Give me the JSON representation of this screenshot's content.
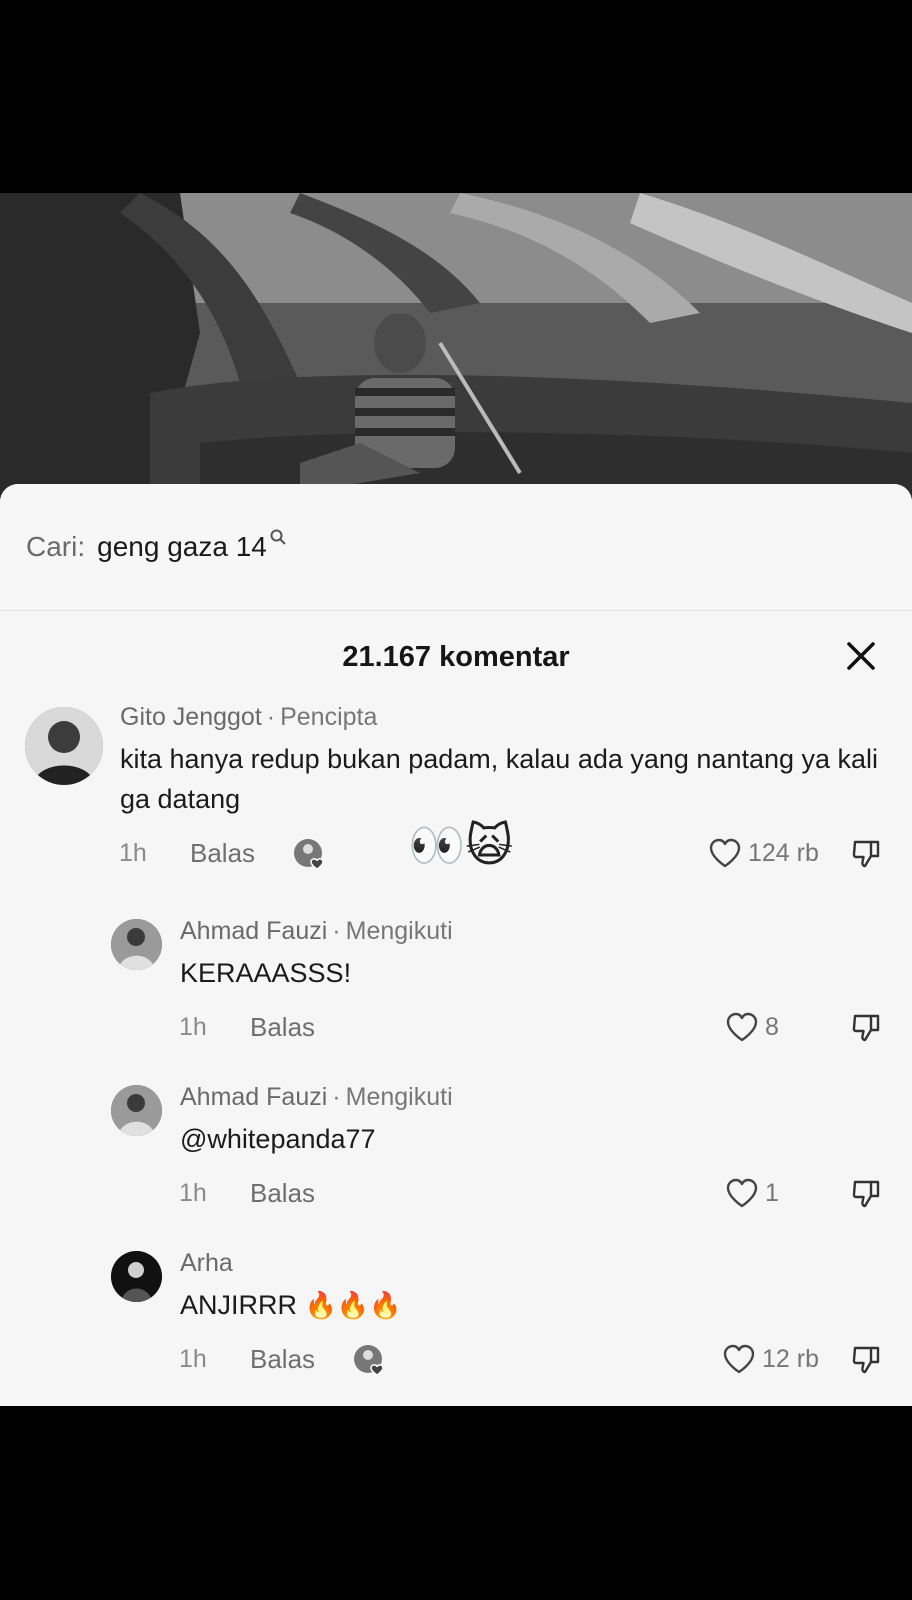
{
  "search": {
    "prefix": "Cari:",
    "query": "geng gaza 14"
  },
  "comments_header": {
    "count_label": "21.167 komentar"
  },
  "comments": [
    {
      "username": "Gito Jenggot",
      "badge": "Pencipta",
      "text": "kita hanya redup bukan padam, kalau ada yang nantang ya kali ga datang",
      "time": "1h",
      "reply_label": "Balas",
      "reaction_emoji": "👀🙀",
      "likes": "124 rb"
    },
    {
      "username": "Ahmad  Fauzi",
      "badge": "Mengikuti",
      "text": "KERAAASSS!",
      "time": "1h",
      "reply_label": "Balas",
      "likes": "8"
    },
    {
      "username": "Ahmad  Fauzi",
      "badge": "Mengikuti",
      "text": "@whitepanda77",
      "time": "1h",
      "reply_label": "Balas",
      "likes": "1"
    },
    {
      "username": "Arha",
      "badge": "",
      "text": "ANJIRRR",
      "text_emoji": "🔥🔥🔥",
      "time": "1h",
      "reply_label": "Balas",
      "likes": "12 rb"
    }
  ],
  "icons": {
    "search": "search-icon",
    "close": "close-icon",
    "like": "heart-outline-icon",
    "dislike": "thumbs-down-icon"
  }
}
